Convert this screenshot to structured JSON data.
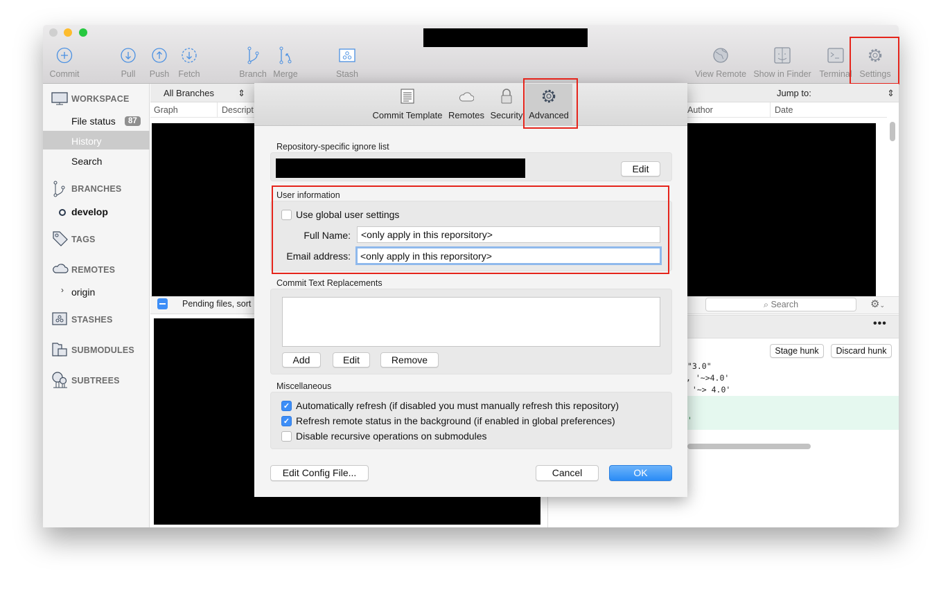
{
  "toolbar": {
    "items": [
      {
        "label": "Commit",
        "icon": "plus-circle-icon"
      },
      {
        "label": "Pull",
        "icon": "arrow-down-circle-icon"
      },
      {
        "label": "Push",
        "icon": "arrow-up-circle-icon"
      },
      {
        "label": "Fetch",
        "icon": "dashed-arrow-down-circle-icon"
      },
      {
        "label": "Branch",
        "icon": "branch-icon"
      },
      {
        "label": "Merge",
        "icon": "merge-icon"
      },
      {
        "label": "Stash",
        "icon": "stash-icon"
      },
      {
        "label": "View Remote",
        "icon": "globe-icon"
      },
      {
        "label": "Show in Finder",
        "icon": "finder-icon"
      },
      {
        "label": "Terminal",
        "icon": "terminal-icon"
      },
      {
        "label": "Settings",
        "icon": "gear-icon"
      }
    ]
  },
  "sidebar": {
    "workspace": "WORKSPACE",
    "file_status": "File status",
    "file_status_count": "87",
    "history": "History",
    "search": "Search",
    "branches": "BRANCHES",
    "branch_current": "develop",
    "tags": "TAGS",
    "remotes": "REMOTES",
    "remote_origin": "origin",
    "stashes": "STASHES",
    "submodules": "SUBMODULES",
    "subtrees": "SUBTREES"
  },
  "history": {
    "branch_filter": "All Branches",
    "jump_to": "Jump to:",
    "columns": [
      "Graph",
      "Descript",
      "Author",
      "Date"
    ],
    "pending": "Pending files, sort"
  },
  "diff": {
    "search_placeholder": "Search",
    "stage_hunk": "Stage hunk",
    "discard_hunk": "Discard hunk",
    "lines": [
      "\"3.0\"",
      ", '~>4.0'",
      " '~> 4.0'",
      "'"
    ]
  },
  "dialog": {
    "tabs": [
      {
        "label": "Commit Template",
        "icon": "document-icon"
      },
      {
        "label": "Remotes",
        "icon": "cloud-icon"
      },
      {
        "label": "Security",
        "icon": "lock-icon"
      },
      {
        "label": "Advanced",
        "icon": "gear-icon",
        "selected": true
      }
    ],
    "ignore_title": "Repository-specific ignore list",
    "ignore_edit": "Edit",
    "user_info_title": "User information",
    "use_global": "Use global user settings",
    "use_global_checked": false,
    "full_name_label": "Full Name:",
    "full_name_value": "<only apply in this reporsitory>",
    "email_label": "Email address:",
    "email_value": "<only apply in this reporsitory>",
    "replacements_title": "Commit Text Replacements",
    "add": "Add",
    "edit": "Edit",
    "remove": "Remove",
    "misc_title": "Miscellaneous",
    "misc": [
      {
        "label": "Automatically refresh (if disabled you must manually refresh this repository)",
        "checked": true
      },
      {
        "label": "Refresh remote status in the background (if enabled in global preferences)",
        "checked": true
      },
      {
        "label": "Disable recursive operations on submodules",
        "checked": false
      }
    ],
    "edit_config": "Edit Config File...",
    "cancel": "Cancel",
    "ok": "OK"
  },
  "colors": {
    "accent": "#3d8ef7",
    "highlight": "#e5241b",
    "icon_blue": "#4a90e2"
  }
}
